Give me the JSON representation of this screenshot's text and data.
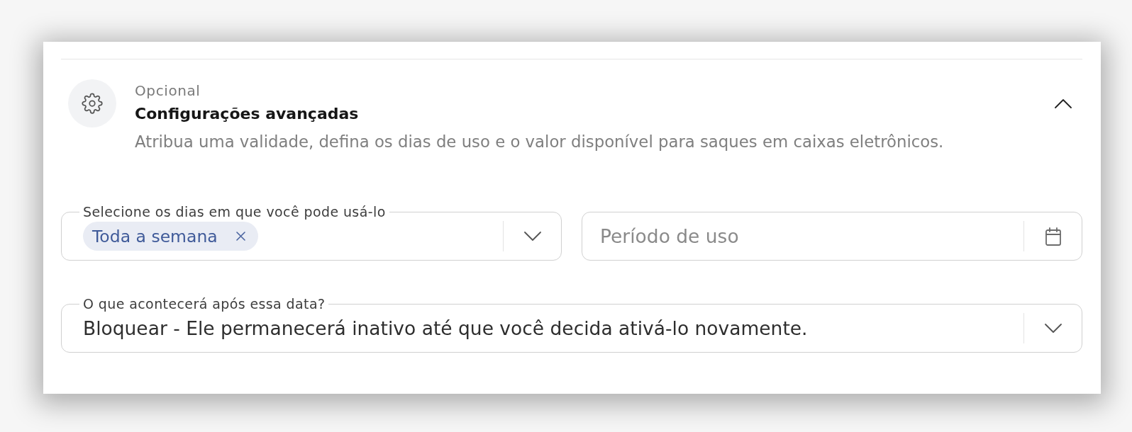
{
  "section": {
    "overline": "Opcional",
    "title": "Configurações avançadas",
    "description": "Atribua uma validade, defina os dias de uso e o valor disponível para saques em caixas eletrônicos.",
    "expanded": true
  },
  "form_rows": [
    {
      "fields": [
        {
          "kind": "multiselect",
          "label": "Selecione os dias em que você pode usá-lo",
          "chips": [
            {
              "label": "Toda a semana"
            }
          ]
        },
        {
          "kind": "date",
          "placeholder": "Período de uso"
        }
      ]
    },
    {
      "fields": [
        {
          "kind": "select",
          "label": "O que acontecerá após essa data?",
          "value": "Bloquear - Ele permanecerá inativo até que você decida ativá-lo novamente."
        }
      ]
    }
  ]
}
